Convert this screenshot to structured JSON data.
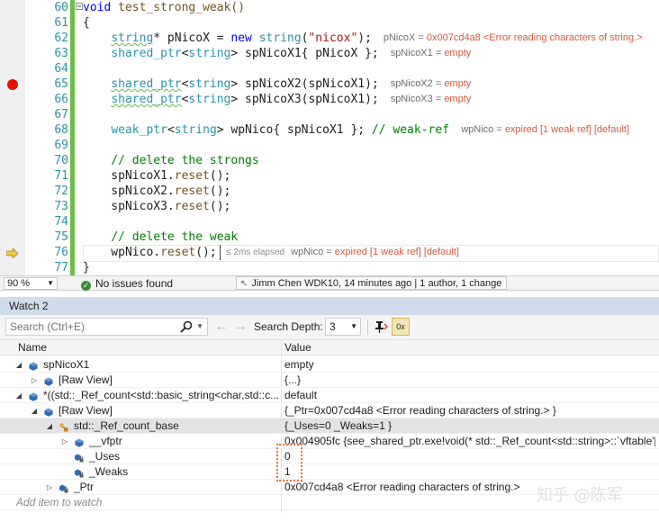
{
  "editor": {
    "line_numbers": [
      "60",
      "61",
      "62",
      "63",
      "64",
      "65",
      "66",
      "67",
      "68",
      "69",
      "70",
      "71",
      "72",
      "73",
      "74",
      "75",
      "76",
      "77"
    ],
    "lines": [
      [
        {
          "t": "void",
          "c": "kw"
        },
        {
          "t": " test_strong_weak()",
          "c": "fn"
        }
      ],
      [
        {
          "t": "{",
          "c": "pl"
        }
      ],
      [
        {
          "t": "    ",
          "c": "pl"
        },
        {
          "t": "string",
          "c": "ty sq"
        },
        {
          "t": "* pNicoX = ",
          "c": "pl"
        },
        {
          "t": "new",
          "c": "kw"
        },
        {
          "t": " ",
          "c": "pl"
        },
        {
          "t": "string",
          "c": "ty"
        },
        {
          "t": "(",
          "c": "pl"
        },
        {
          "t": "\"nicox\"",
          "c": "st"
        },
        {
          "t": ");",
          "c": "pl"
        }
      ],
      [
        {
          "t": "    ",
          "c": "pl"
        },
        {
          "t": "shared_ptr",
          "c": "ty"
        },
        {
          "t": "<",
          "c": "pl"
        },
        {
          "t": "string",
          "c": "ty"
        },
        {
          "t": "> spNicoX1{ pNicoX };",
          "c": "pl"
        }
      ],
      [],
      [
        {
          "t": "    ",
          "c": "pl"
        },
        {
          "t": "shared_ptr",
          "c": "ty sq"
        },
        {
          "t": "<",
          "c": "pl"
        },
        {
          "t": "string",
          "c": "ty"
        },
        {
          "t": "> spNicoX2(spNicoX1);",
          "c": "pl"
        }
      ],
      [
        {
          "t": "    ",
          "c": "pl"
        },
        {
          "t": "shared_ptr",
          "c": "ty sq"
        },
        {
          "t": "<",
          "c": "pl"
        },
        {
          "t": "string",
          "c": "ty"
        },
        {
          "t": "> spNicoX3(spNicoX1);",
          "c": "pl"
        }
      ],
      [],
      [
        {
          "t": "    ",
          "c": "pl"
        },
        {
          "t": "weak_ptr",
          "c": "ty"
        },
        {
          "t": "<",
          "c": "pl"
        },
        {
          "t": "string",
          "c": "ty"
        },
        {
          "t": "> wpNico{ spNicoX1 }; ",
          "c": "pl"
        },
        {
          "t": "// weak-ref",
          "c": "cm"
        }
      ],
      [],
      [
        {
          "t": "    ",
          "c": "pl"
        },
        {
          "t": "// delete the strongs",
          "c": "cm"
        }
      ],
      [
        {
          "t": "    spNicoX1.",
          "c": "pl"
        },
        {
          "t": "reset",
          "c": "fn"
        },
        {
          "t": "();",
          "c": "pl"
        }
      ],
      [
        {
          "t": "    spNicoX2.",
          "c": "pl"
        },
        {
          "t": "reset",
          "c": "fn"
        },
        {
          "t": "();",
          "c": "pl"
        }
      ],
      [
        {
          "t": "    spNicoX3.",
          "c": "pl"
        },
        {
          "t": "reset",
          "c": "fn"
        },
        {
          "t": "();",
          "c": "pl"
        }
      ],
      [],
      [
        {
          "t": "    ",
          "c": "pl"
        },
        {
          "t": "// delete the weak",
          "c": "cm"
        }
      ],
      [
        {
          "t": "    wpNico.",
          "c": "pl"
        },
        {
          "t": "reset",
          "c": "fn"
        },
        {
          "t": "();",
          "c": "pl"
        }
      ],
      [
        {
          "t": "}",
          "c": "pl"
        }
      ]
    ],
    "datatips": [
      {
        "line": 2,
        "name": "pNicoX",
        "value": "0x007cd4a8 <Error reading characters of string.>"
      },
      {
        "line": 3,
        "name": "spNicoX1",
        "value": "empty"
      },
      {
        "line": 5,
        "name": "spNicoX2",
        "value": "empty"
      },
      {
        "line": 6,
        "name": "spNicoX3",
        "value": "empty"
      },
      {
        "line": 8,
        "name": "wpNico",
        "value": "expired [1 weak ref] [default]"
      },
      {
        "line": 16,
        "name": "wpNico",
        "value": "expired [1 weak ref] [default]"
      }
    ],
    "elapsed": "≤ 2ms elapsed"
  },
  "editor_status": {
    "zoom": "90 %",
    "issues": "No issues found",
    "codelens": "Jimm Chen WDK10, 14 minutes ago | 1 author, 1 change"
  },
  "watch": {
    "title": "Watch 2",
    "search_placeholder": "Search (Ctrl+E)",
    "search_depth_label": "Search Depth:",
    "search_depth_value": "3",
    "hex_label": "0x",
    "columns": {
      "name": "Name",
      "value": "Value"
    },
    "rows": [
      {
        "depth": 0,
        "expander": "open",
        "icon": "object",
        "name": "spNicoX1",
        "value": "empty"
      },
      {
        "depth": 1,
        "expander": "closed",
        "icon": "object",
        "name": "[Raw View]",
        "value": "{...}"
      },
      {
        "depth": 0,
        "expander": "open",
        "icon": "object",
        "name": "*((std::_Ref_count<std::basic_string<char,std::c...",
        "value": "default"
      },
      {
        "depth": 1,
        "expander": "open",
        "icon": "object",
        "name": "[Raw View]",
        "value": "{_Ptr=0x007cd4a8 <Error reading characters of string.> }"
      },
      {
        "depth": 2,
        "expander": "open",
        "icon": "base-class",
        "name": "std::_Ref_count_base",
        "value": "{_Uses=0 _Weaks=1 }",
        "selected": true
      },
      {
        "depth": 3,
        "expander": "closed",
        "icon": "object",
        "name": "__vfptr",
        "value": "0x004905fc {see_shared_ptr.exe!void(* std::_Ref_count<std::string>::`vftable'[..."
      },
      {
        "depth": 3,
        "expander": "none",
        "icon": "field-lock",
        "name": "_Uses",
        "value": "0"
      },
      {
        "depth": 3,
        "expander": "none",
        "icon": "field-lock",
        "name": "_Weaks",
        "value": "1"
      },
      {
        "depth": 2,
        "expander": "closed",
        "icon": "field-lock",
        "name": "_Ptr",
        "value": "0x007cd4a8 <Error reading characters of string.>"
      }
    ],
    "add_item_placeholder": "Add item to watch"
  },
  "watermark": "知乎 @陈军",
  "colors": {
    "line_number": "#2b91af",
    "keyword": "#0000ff",
    "type": "#2b91af",
    "string": "#a31515",
    "comment": "#008000",
    "change_bar": "#6cbd45",
    "breakpoint": "#e51400",
    "datatip_value": "#d35b3c",
    "watch_title_bg": "#cfdcec",
    "highlight": "#e8743b"
  }
}
